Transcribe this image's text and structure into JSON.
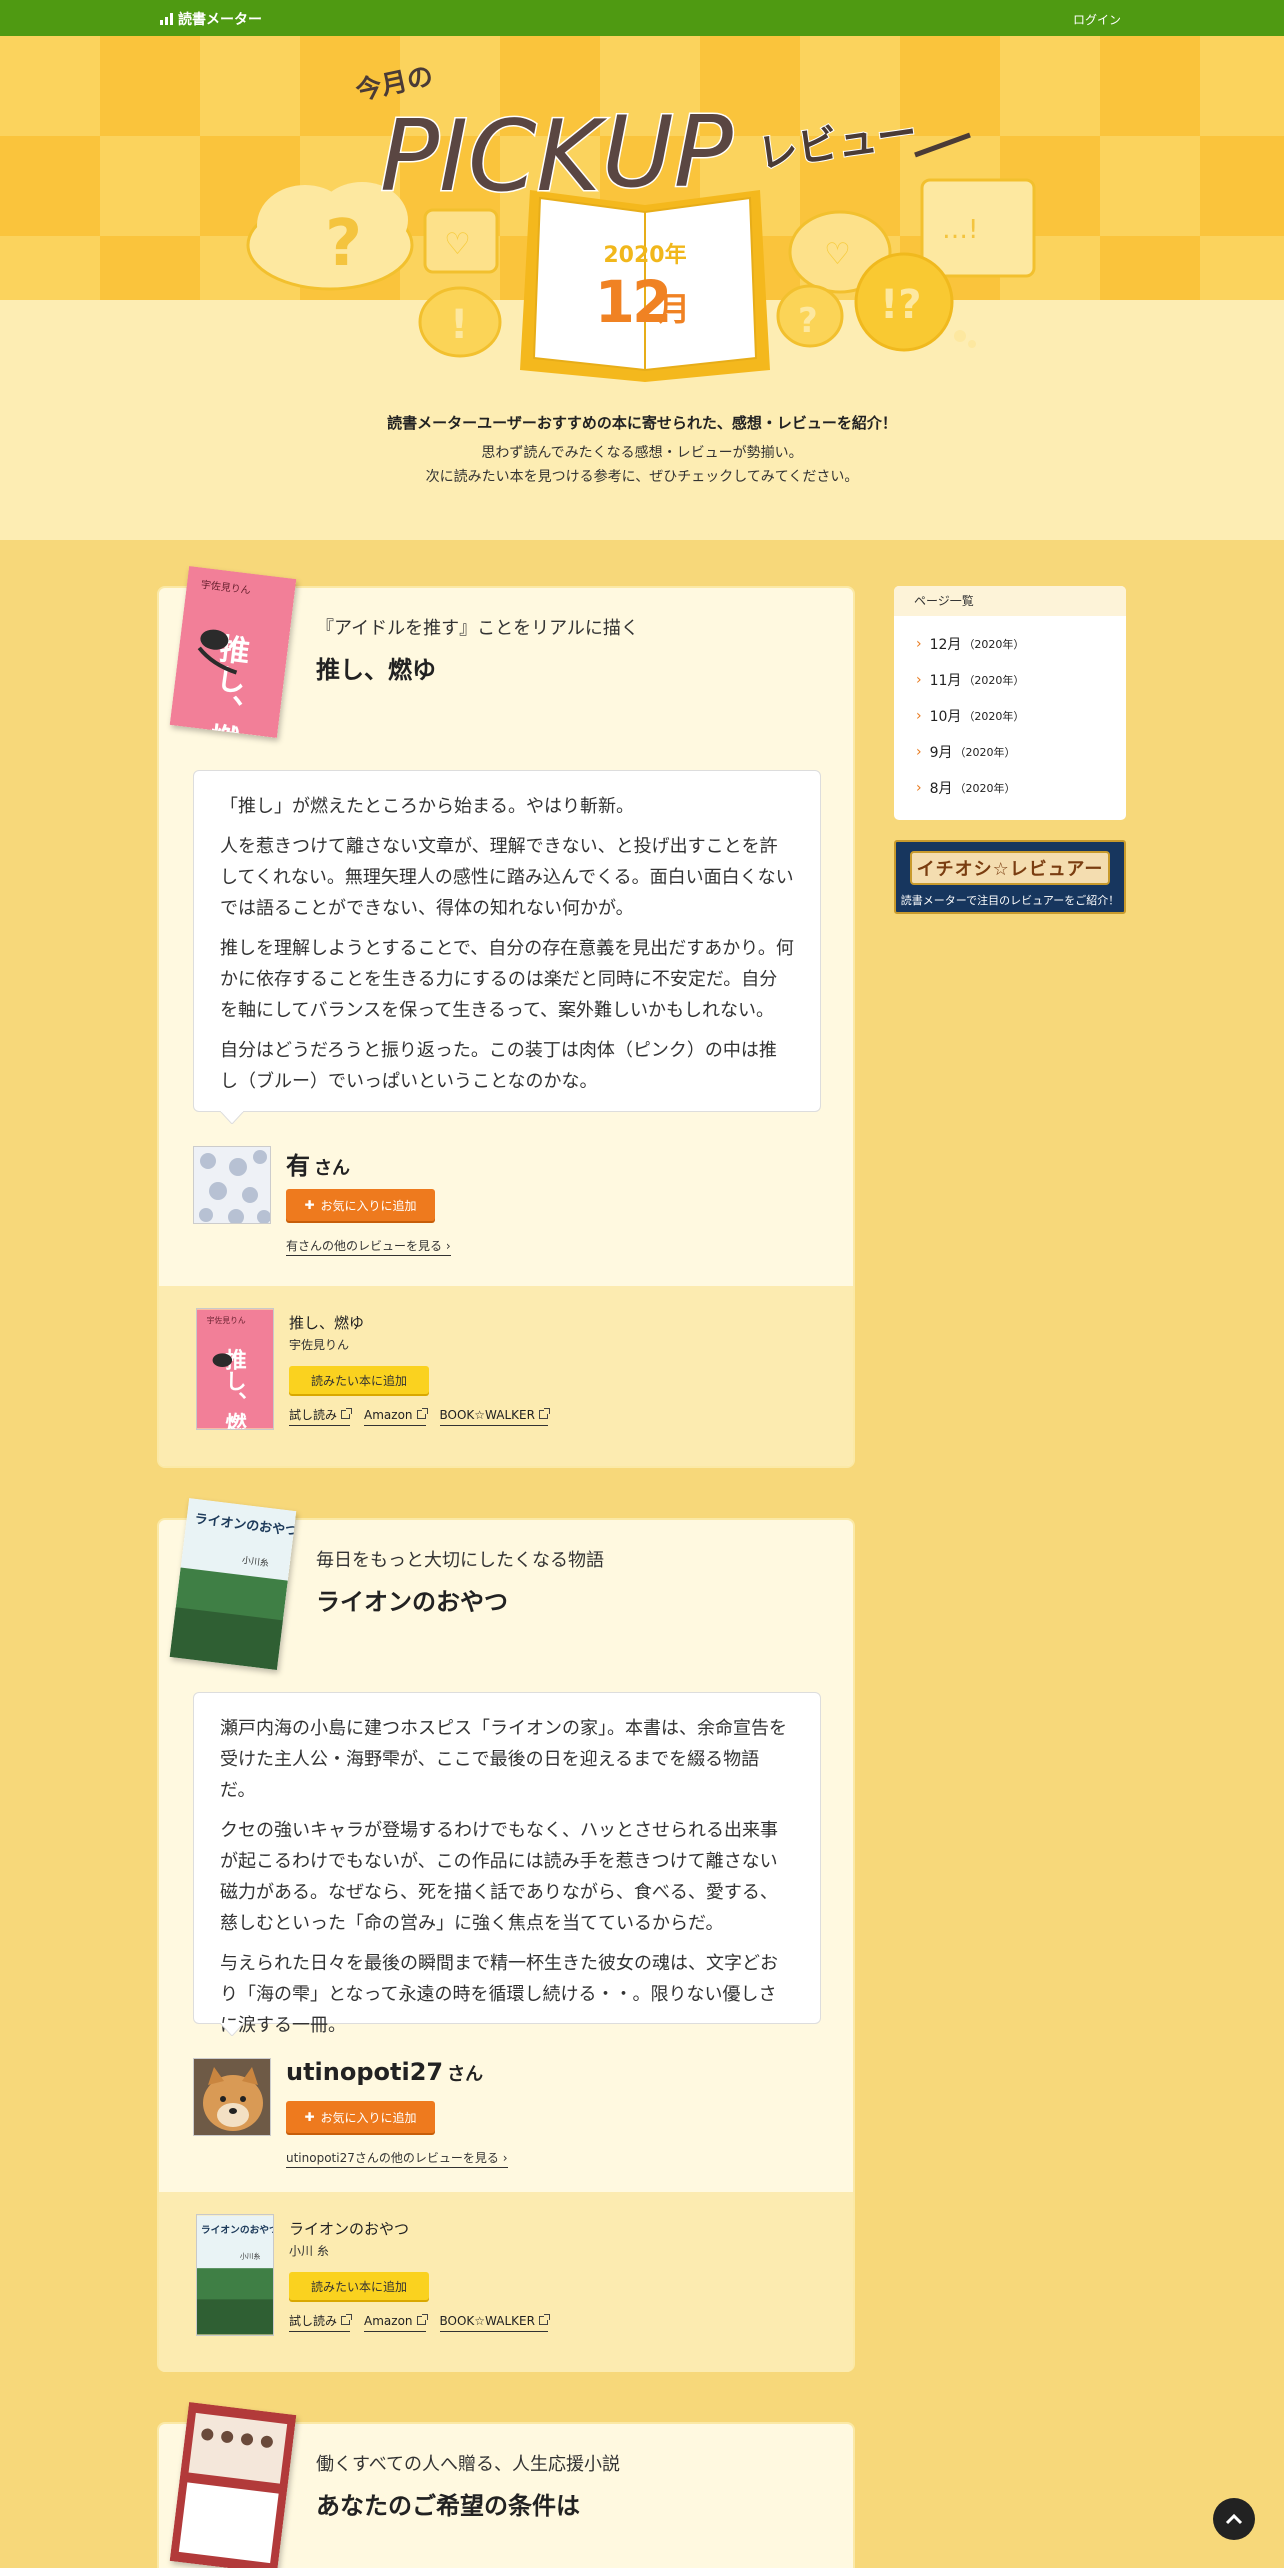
{
  "header": {
    "logo_text": "読書メーター",
    "login_label": "ログイン"
  },
  "hero": {
    "kicker": "今月の",
    "pick": "PICK",
    "up": "UP",
    "review_word": "レビュー",
    "year": "2020年",
    "month_num": "12",
    "month_unit": "月",
    "lead": "読書メーターユーザーおすすめの本に寄せられた、感想・レビューを紹介！",
    "sub1": "思わず読んでみたくなる感想・レビューが勢揃い。",
    "sub2": "次に読みたい本を見つける参考に、ぜひチェックしてみてください。"
  },
  "reviews": [
    {
      "tagline": "『アイドルを推す』ことをリアルに描く",
      "title": "推し、燃ゆ",
      "paragraphs": [
        "「推し」が燃えたところから始まる。やはり斬新。",
        "人を惹きつけて離さない文章が、理解できない、と投げ出すことを許してくれない。無理矢理人の感性に踏み込んでくる。面白い面白くないでは語ることができない、得体の知れない何かが。",
        "推しを理解しようとすることで、自分の存在意義を見出だすあかり。何かに依存することを生きる力にするのは楽だと同時に不安定だ。自分を軸にしてバランスを保って生きるって、案外難しいかもしれない。",
        "自分はどうだろうと振り返った。この装丁は肉体（ピンク）の中は推し（ブルー）でいっぱいということなのかな。"
      ],
      "reviewer": "有",
      "san": "さん",
      "fav_label": "お気に入りに追加",
      "more_label": "有さんの他のレビューを見る",
      "book_title": "推し、燃ゆ",
      "author": "宇佐見りん",
      "want_label": "読みたい本に追加",
      "links": [
        "試し読み",
        "Amazon",
        "BOOK☆WALKER"
      ],
      "cover_title": "推し、燃ゆ",
      "cover_author": "宇佐見りん"
    },
    {
      "tagline": "毎日をもっと大切にしたくなる物語",
      "title": "ライオンのおやつ",
      "paragraphs": [
        "瀬戸内海の小島に建つホスピス「ライオンの家」。本書は、余命宣告を受けた主人公・海野雫が、ここで最後の日を迎えるまでを綴る物語だ。",
        "クセの強いキャラが登場するわけでもなく、ハッとさせられる出来事が起こるわけでもないが、この作品には読み手を惹きつけて離さない磁力がある。なぜなら、死を描く話でありながら、食べる、愛する、慈しむといった「命の営み」に強く焦点を当てているからだ。",
        "与えられた日々を最後の瞬間まで精一杯生きた彼女の魂は、文字どおり「海の雫」となって永遠の時を循環し続ける・・。限りない優しさに涙する一冊。"
      ],
      "reviewer": "utinopoti27",
      "san": "さん",
      "fav_label": "お気に入りに追加",
      "more_label": "utinopoti27さんの他のレビューを見る",
      "book_title": "ライオンのおやつ",
      "author": "小川 糸",
      "want_label": "読みたい本に追加",
      "links": [
        "試し読み",
        "Amazon",
        "BOOK☆WALKER"
      ],
      "cover_title": "ライオンのおやつ",
      "cover_author": "小川糸"
    },
    {
      "tagline": "働くすべての人へ贈る、人生応援小説",
      "title": "あなたのご希望の条件は"
    }
  ],
  "sidebar": {
    "heading": "ページ一覧",
    "items": [
      {
        "label": "12月",
        "year": "（2020年）"
      },
      {
        "label": "11月",
        "year": "（2020年）"
      },
      {
        "label": "10月",
        "year": "（2020年）"
      },
      {
        "label": "9月",
        "year": "（2020年）"
      },
      {
        "label": "8月",
        "year": "（2020年）"
      }
    ],
    "banner_title": "イチオシ☆レビュアー",
    "banner_sub": "読書メーターで注目のレビュアーをご紹介！"
  },
  "colors": {
    "header_green": "#4f9a12",
    "accent_orange": "#ee7a1e",
    "want_yellow": "#fad21f",
    "page_bg": "#f7d87a"
  }
}
